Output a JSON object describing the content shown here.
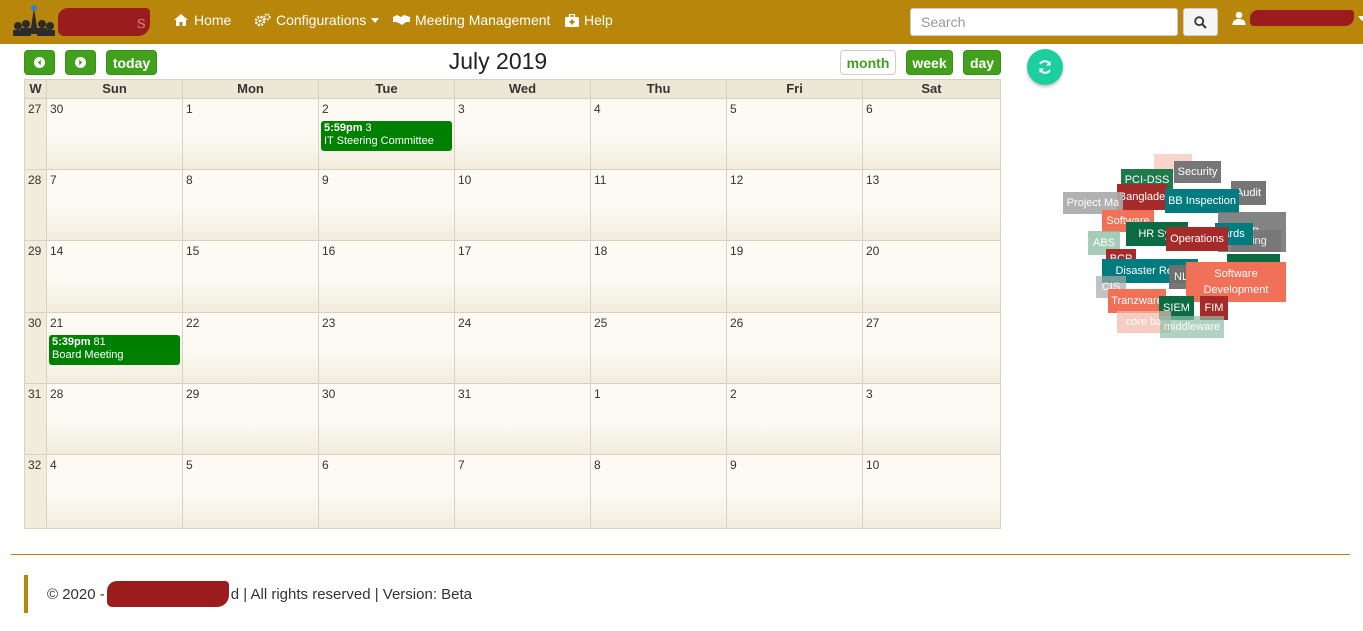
{
  "nav": {
    "home": "Home",
    "configurations": "Configurations",
    "meeting_management": "Meeting Management",
    "help": "Help",
    "search_placeholder": "Search"
  },
  "toolbar": {
    "today": "today",
    "title": "July 2019",
    "views": [
      "month",
      "week",
      "day"
    ],
    "active_view": "month"
  },
  "calendar": {
    "week_label": "W",
    "days": [
      "Sun",
      "Mon",
      "Tue",
      "Wed",
      "Thu",
      "Fri",
      "Sat"
    ],
    "weeks": [
      {
        "week": "27",
        "dates": [
          "30",
          "1",
          "2",
          "3",
          "4",
          "5",
          "6"
        ]
      },
      {
        "week": "28",
        "dates": [
          "7",
          "8",
          "9",
          "10",
          "11",
          "12",
          "13"
        ]
      },
      {
        "week": "29",
        "dates": [
          "14",
          "15",
          "16",
          "17",
          "18",
          "19",
          "20"
        ]
      },
      {
        "week": "30",
        "dates": [
          "21",
          "22",
          "23",
          "24",
          "25",
          "26",
          "27"
        ]
      },
      {
        "week": "31",
        "dates": [
          "28",
          "29",
          "30",
          "31",
          "1",
          "2",
          "3"
        ]
      },
      {
        "week": "32",
        "dates": [
          "4",
          "5",
          "6",
          "7",
          "8",
          "9",
          "10"
        ]
      }
    ],
    "events": [
      {
        "week": 0,
        "day": 2,
        "time": "5:59pm",
        "num": "3",
        "title": "IT Steering Committee"
      },
      {
        "week": 3,
        "day": 0,
        "time": "5:39pm",
        "num": "81",
        "title": "Board Meeting"
      }
    ]
  },
  "tags": [
    {
      "text": "Security",
      "color": "#777777"
    },
    {
      "text": "PCI-DSS",
      "color": "#1f7a4a"
    },
    {
      "text": "Audit",
      "color": "#6f6f6f"
    },
    {
      "text": "Banglade",
      "color": "#a52a2a"
    },
    {
      "text": "BB Inspection",
      "color": "#007b7f"
    },
    {
      "text": "Project Ma",
      "color": "#a9a9a9"
    },
    {
      "text": "Software",
      "color": "#f07058"
    },
    {
      "text": "BB",
      "color": "#777777"
    },
    {
      "text": "rting",
      "color": "#777777"
    },
    {
      "text": "HR Sys",
      "color": "#0b6b42"
    },
    {
      "text": "ards",
      "color": "#007b7f"
    },
    {
      "text": "Operations",
      "color": "#a52a2a"
    },
    {
      "text": "ABS",
      "color": "#8fbfa8"
    },
    {
      "text": "BCP",
      "color": "#a52a2a"
    },
    {
      "text": "Disaster Reco",
      "color": "#007b7f"
    },
    {
      "text": "NLOS",
      "color": "#6f6f6f"
    },
    {
      "text": "Software Development",
      "color": "#f07058"
    },
    {
      "text": "CIS",
      "color": "#a9a9a9"
    },
    {
      "text": "Tranzware",
      "color": "#f07058"
    },
    {
      "text": "SIEM",
      "color": "#0b6b42"
    },
    {
      "text": "FIM",
      "color": "#a52a2a"
    },
    {
      "text": "core ba",
      "color": "#f4b8aa"
    },
    {
      "text": "middleware",
      "color": "#8fbfa8"
    }
  ],
  "footer": {
    "copyright": "© 2020 -",
    "suffix": "d | All rights reserved | Version: Beta"
  }
}
